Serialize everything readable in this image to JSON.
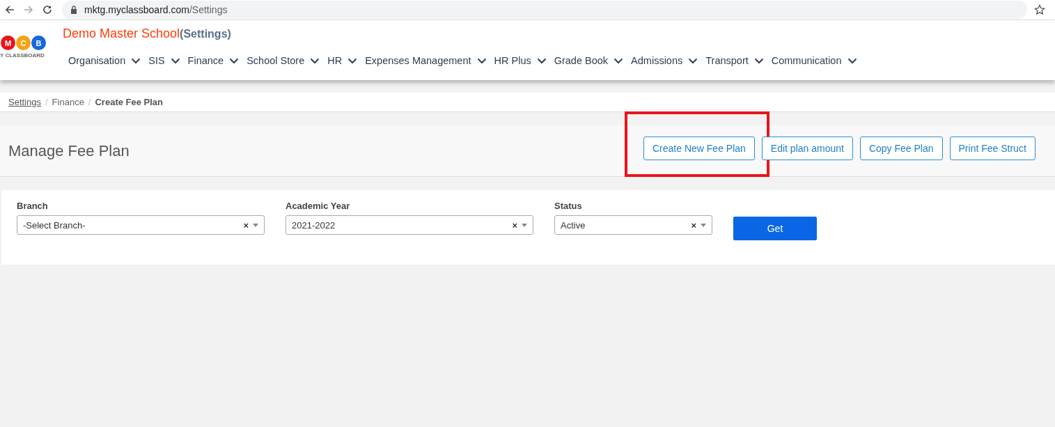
{
  "browser": {
    "url_host": "mktg.myclassboard.com",
    "url_path": "/Settings"
  },
  "logo": {
    "letters": [
      {
        "text": "M",
        "color": "#e8141b"
      },
      {
        "text": "C",
        "color": "#f5a316"
      },
      {
        "text": "B",
        "color": "#1468e0"
      }
    ],
    "caption": "Y CLASSBOARD"
  },
  "header": {
    "school": "Demo Master School",
    "context": "(Settings)"
  },
  "nav": [
    {
      "label": "Organisation"
    },
    {
      "label": "SIS"
    },
    {
      "label": "Finance"
    },
    {
      "label": "School Store"
    },
    {
      "label": "HR"
    },
    {
      "label": "Expenses Management"
    },
    {
      "label": "HR Plus"
    },
    {
      "label": "Grade Book"
    },
    {
      "label": "Admissions"
    },
    {
      "label": "Transport"
    },
    {
      "label": "Communication"
    }
  ],
  "breadcrumb": [
    {
      "label": "Settings",
      "kind": "link"
    },
    {
      "separator": "/",
      "label": "Finance",
      "kind": "plain"
    },
    {
      "separator": "/",
      "label": "Create Fee Plan",
      "kind": "current"
    }
  ],
  "panel": {
    "title": "Manage Fee Plan",
    "buttons": [
      {
        "label": "Create New Fee Plan",
        "highlighted": true
      },
      {
        "label": "Edit plan amount",
        "highlighted": false
      },
      {
        "label": "Copy Fee Plan",
        "highlighted": false
      },
      {
        "label": "Print Fee Struct",
        "highlighted": false
      }
    ]
  },
  "filters": [
    {
      "label": "Branch",
      "value": "-Select Branch-",
      "clear": "×"
    },
    {
      "label": "Academic Year",
      "value": "2021-2022",
      "clear": "×"
    },
    {
      "label": "Status",
      "value": "Active",
      "clear": "×"
    }
  ],
  "get_button": "Get"
}
